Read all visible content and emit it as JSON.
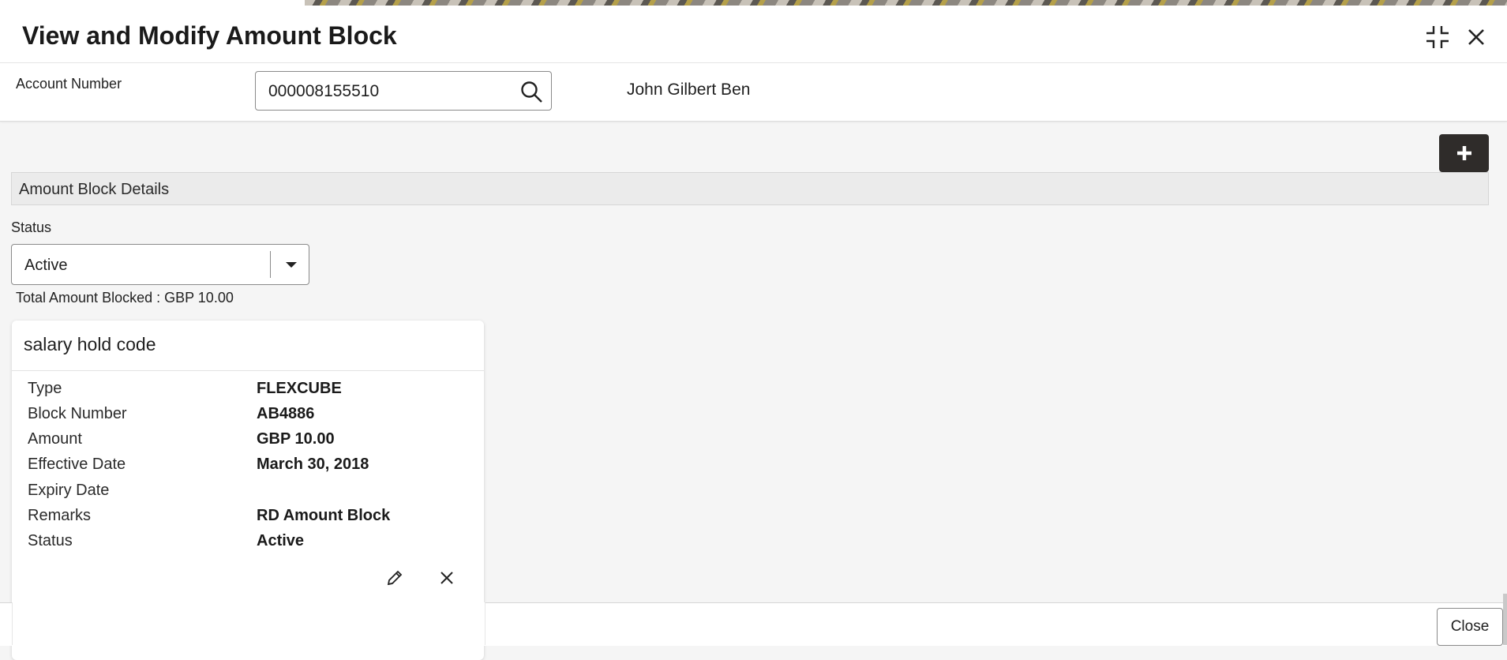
{
  "header": {
    "title": "View and Modify Amount Block",
    "minimize_icon": "collapse-icon",
    "close_icon": "close-icon"
  },
  "account": {
    "label": "Account Number",
    "value": "000008155510",
    "customer_name": "John Gilbert Ben"
  },
  "section": {
    "title": "Amount Block Details",
    "status_label": "Status",
    "status_value": "Active",
    "total_blocked": "Total Amount Blocked : GBP 10.00"
  },
  "card": {
    "title": "salary hold code",
    "rows": [
      {
        "key": "Type",
        "value": "FLEXCUBE"
      },
      {
        "key": "Block Number",
        "value": "AB4886"
      },
      {
        "key": "Amount",
        "value": "GBP 10.00"
      },
      {
        "key": "Effective Date",
        "value": "March 30, 2018"
      },
      {
        "key": "Expiry Date",
        "value": ""
      },
      {
        "key": "Remarks",
        "value": "RD Amount Block"
      },
      {
        "key": "Status",
        "value": "Active"
      }
    ]
  },
  "footer": {
    "close_label": "Close"
  },
  "colors": {
    "add_button_bg": "#2f2c2a",
    "section_bg": "#ebebeb",
    "page_bg": "#f5f5f5"
  }
}
